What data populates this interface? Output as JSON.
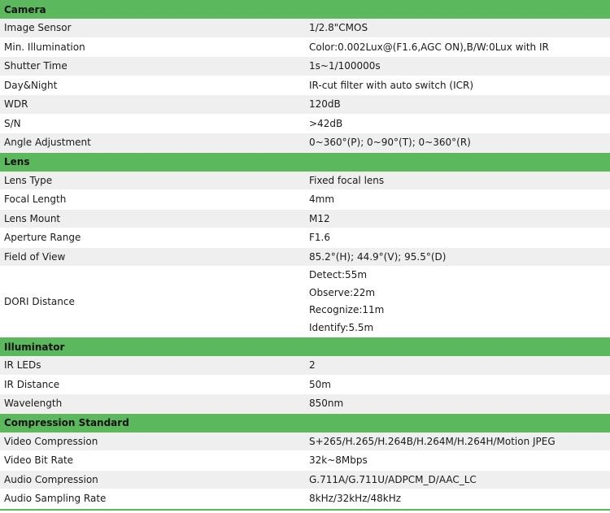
{
  "sections": [
    {
      "title": "Camera",
      "rows": [
        {
          "label": "Image Sensor",
          "value": "1/2.8\"CMOS"
        },
        {
          "label": "Min. Illumination",
          "value": "Color:0.002Lux@(F1.6,AGC ON),B/W:0Lux with IR"
        },
        {
          "label": "Shutter Time",
          "value": "1s~1/100000s"
        },
        {
          "label": "Day&Night",
          "value": "IR-cut filter with auto switch (ICR)"
        },
        {
          "label": "WDR",
          "value": "120dB"
        },
        {
          "label": "S/N",
          "value": ">42dB"
        },
        {
          "label": "Angle Adjustment",
          "value": "0~360°(P); 0~90°(T); 0~360°(R)"
        }
      ]
    },
    {
      "title": "Lens",
      "rows": [
        {
          "label": "Lens Type",
          "value": "Fixed focal lens"
        },
        {
          "label": "Focal Length",
          "value": "4mm"
        },
        {
          "label": "Lens Mount",
          "value": "M12"
        },
        {
          "label": "Aperture Range",
          "value": "F1.6"
        },
        {
          "label": "Field of View",
          "value": "85.2°(H); 44.9°(V); 95.5°(D)"
        },
        {
          "label": "DORI Distance",
          "values": [
            "Detect:55m",
            "Observe:22m",
            "Recognize:11m",
            "Identify:5.5m"
          ]
        }
      ]
    },
    {
      "title": "Illuminator",
      "rows": [
        {
          "label": "IR LEDs",
          "value": "2"
        },
        {
          "label": "IR Distance",
          "value": "50m"
        },
        {
          "label": "Wavelength",
          "value": "850nm"
        }
      ]
    },
    {
      "title": "Compression Standard",
      "rows": [
        {
          "label": "Video Compression",
          "value": "S+265/H.265/H.264B/H.264M/H.264H/Motion JPEG"
        },
        {
          "label": "Video Bit Rate",
          "value": "32k~8Mbps"
        },
        {
          "label": "Audio Compression",
          "value": "G.711A/G.711U/ADPCM_D/AAC_LC"
        },
        {
          "label": "Audio Sampling Rate",
          "value": "8kHz/32kHz/48kHz"
        }
      ]
    }
  ]
}
